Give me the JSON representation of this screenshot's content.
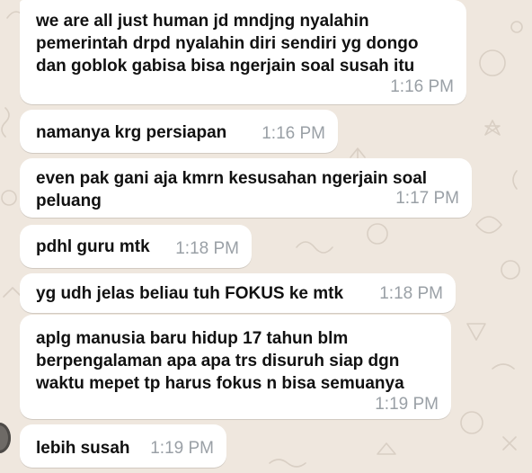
{
  "colors": {
    "background": "#efe7de",
    "bubble": "#ffffff",
    "text": "#111111",
    "timestamp": "#9aa0a6"
  },
  "messages": [
    {
      "text": "we are all just human jd mndjng nyalahin\npemerintah drpd nyalahin diri sendiri yg dongo\ndan goblok gabisa bisa ngerjain soal susah itu",
      "time": "1:16 PM"
    },
    {
      "text": "namanya krg persiapan",
      "time": "1:16 PM"
    },
    {
      "text": "even pak gani aja kmrn kesusahan ngerjain soal\npeluang",
      "time": "1:17 PM"
    },
    {
      "text": "pdhl guru mtk",
      "time": "1:18 PM"
    },
    {
      "text": "yg udh jelas beliau tuh FOKUS ke mtk",
      "time": "1:18 PM"
    },
    {
      "text": "aplg manusia baru hidup 17 tahun blm\nberpengalaman apa apa trs disuruh siap dgn\nwaktu mepet tp harus fokus n bisa semuanya",
      "time": "1:19 PM"
    },
    {
      "text": "lebih susah",
      "time": "1:19 PM"
    }
  ]
}
